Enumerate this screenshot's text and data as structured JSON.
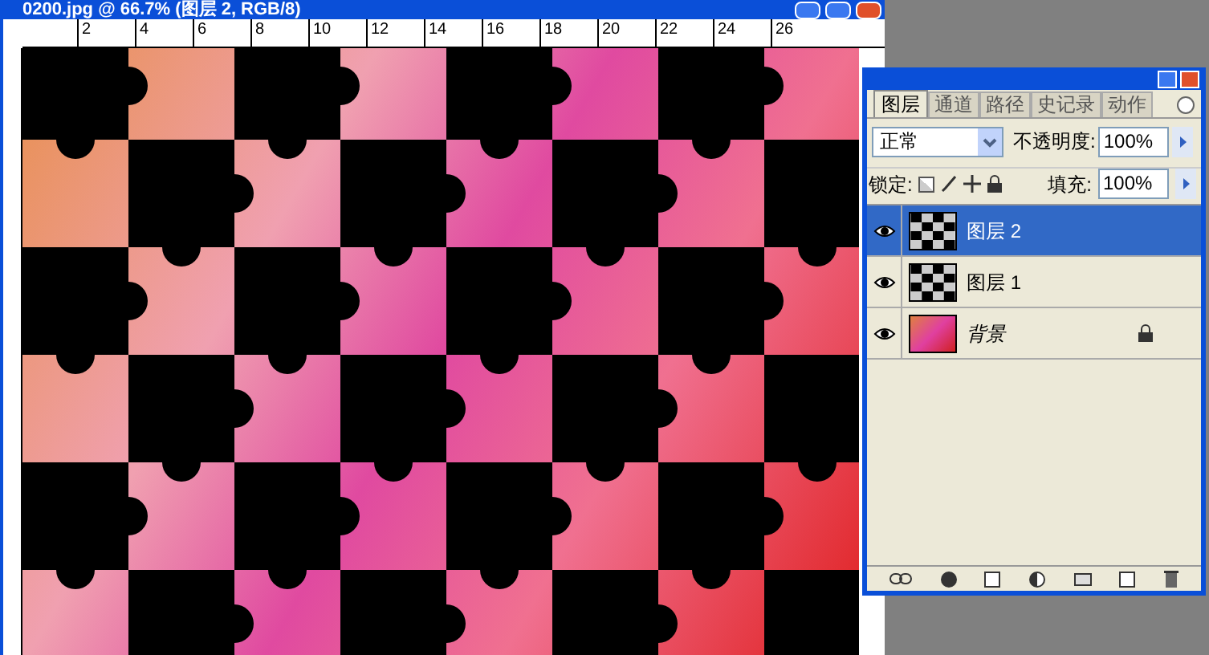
{
  "document": {
    "title": "0200.jpg @ 66.7% (图层 2, RGB/8)",
    "ruler_labels": [
      "2",
      "4",
      "6",
      "8",
      "10",
      "12",
      "14",
      "16",
      "18",
      "20",
      "22",
      "24",
      "26"
    ]
  },
  "layers_panel": {
    "tabs": [
      {
        "label": "图层",
        "selected": true
      },
      {
        "label": "通道",
        "selected": false
      },
      {
        "label": "路径",
        "selected": false
      },
      {
        "label": "史记录",
        "selected": false
      },
      {
        "label": "动作",
        "selected": false
      }
    ],
    "blend_mode": "正常",
    "opacity_label": "不透明度:",
    "opacity": "100%",
    "lock_label": "锁定:",
    "fill_label": "填充:",
    "fill": "100%",
    "layers": [
      {
        "name": "图层 2",
        "selected": true,
        "visible": true,
        "locked": false,
        "kind": "pattern"
      },
      {
        "name": "图层 1",
        "selected": false,
        "visible": true,
        "locked": false,
        "kind": "pattern"
      },
      {
        "name": "背景",
        "selected": false,
        "visible": true,
        "locked": true,
        "kind": "photo"
      }
    ]
  }
}
